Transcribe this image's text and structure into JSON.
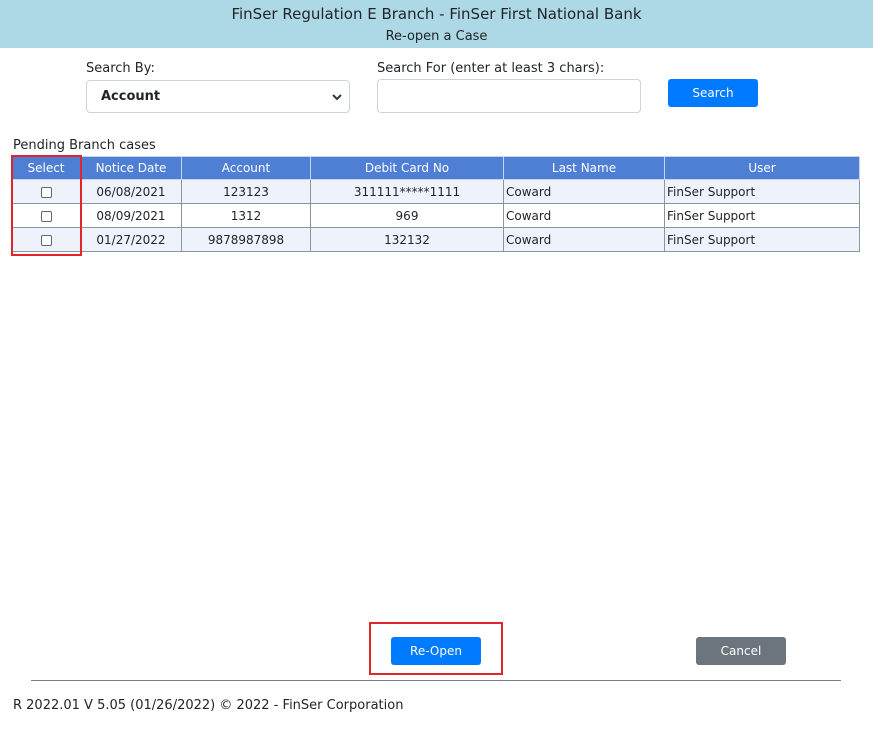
{
  "header": {
    "title": "FinSer Regulation E Branch - FinSer First National Bank",
    "subtitle": "Re-open a Case"
  },
  "search": {
    "by_label": "Search By:",
    "by_value": "Account",
    "for_label": "Search For (enter at least 3 chars):",
    "for_value": "",
    "button_label": "Search"
  },
  "table": {
    "caption": "Pending Branch cases",
    "columns": [
      "Select",
      "Notice Date",
      "Account",
      "Debit Card No",
      "Last Name",
      "User"
    ],
    "rows": [
      {
        "notice_date": "06/08/2021",
        "account": "123123",
        "debit_card": "311111*****1111",
        "last_name": "Coward",
        "user": "FinSer Support"
      },
      {
        "notice_date": "08/09/2021",
        "account": "1312",
        "debit_card": "969",
        "last_name": "Coward",
        "user": "FinSer Support"
      },
      {
        "notice_date": "01/27/2022",
        "account": "9878987898",
        "debit_card": "132132",
        "last_name": "Coward",
        "user": "FinSer Support"
      }
    ]
  },
  "actions": {
    "reopen_label": "Re-Open",
    "cancel_label": "Cancel"
  },
  "footer": {
    "text": "R 2022.01 V 5.05 (01/26/2022) © 2022 - FinSer Corporation"
  },
  "colors": {
    "header_bg": "#add8e6",
    "table_header_bg": "#4f7fd5",
    "primary_button": "#007bff",
    "secondary_button": "#6c757d",
    "highlight": "#e0262b"
  }
}
